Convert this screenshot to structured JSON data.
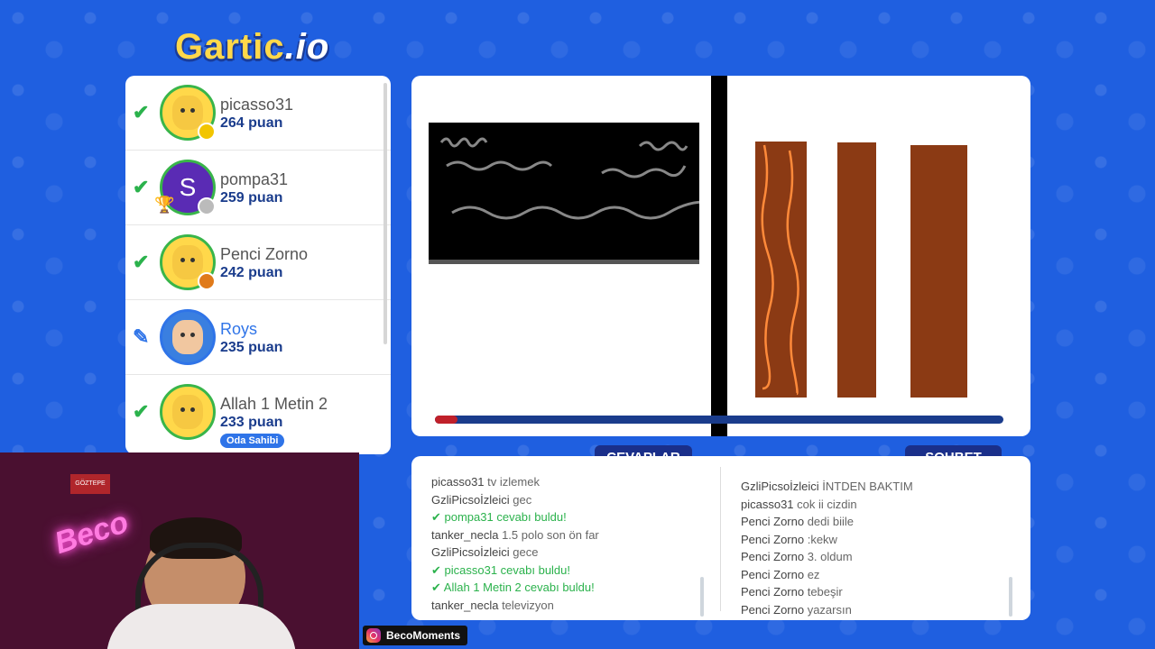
{
  "logo": {
    "name": "Gartic",
    "suffix": ".io"
  },
  "players": [
    {
      "name": "picasso31",
      "score": "264 puan",
      "status": "correct",
      "dot": "#f2c500"
    },
    {
      "name": "pompa31",
      "score": "259 puan",
      "status": "correct",
      "avatar_letter": "S",
      "rank_badge": "1",
      "dot": "#bbbbbb"
    },
    {
      "name": "Penci Zorno",
      "score": "242 puan",
      "status": "correct",
      "dot": "#e07a1a"
    },
    {
      "name": "Roys",
      "score": "235 puan",
      "status": "drawing"
    },
    {
      "name": "Allah 1 Metin 2",
      "score": "233 puan",
      "status": "correct",
      "badge": "Oda Sahibi"
    }
  ],
  "timer": {
    "remaining_fraction": 0.04
  },
  "tabs": {
    "answers": "CEVAPLAR",
    "chat": "SOHBET"
  },
  "answers": [
    {
      "user": "picasso31",
      "text": "tv izlemek"
    },
    {
      "user": "GzliPicsoİzleici",
      "text": "gec"
    },
    {
      "user": "pompa31",
      "text": "cevabı buldu!",
      "correct": true
    },
    {
      "user": "tanker_necla",
      "text": "1.5 polo son ön far"
    },
    {
      "user": "GzliPicsoİzleici",
      "text": "gece"
    },
    {
      "user": "picasso31",
      "text": "cevabı buldu!",
      "correct": true
    },
    {
      "user": "Allah 1 Metin 2",
      "text": "cevabı buldu!",
      "correct": true
    },
    {
      "user": "tanker_necla",
      "text": "televizyon"
    }
  ],
  "chat": [
    {
      "user": "GzliPicsoİzleici",
      "text": "İNTDEN BAKTIM"
    },
    {
      "user": "picasso31",
      "text": "cok ii cizdin"
    },
    {
      "user": "Penci Zorno",
      "text": "dedi biile"
    },
    {
      "user": "Penci Zorno",
      "text": ":kekw"
    },
    {
      "user": "Penci Zorno",
      "text": "3. oldum"
    },
    {
      "user": "Penci Zorno",
      "text": "ez"
    },
    {
      "user": "Penci Zorno",
      "text": "tebeşir"
    },
    {
      "user": "Penci Zorno",
      "text": "yazarsın"
    }
  ],
  "webcam": {
    "neon_text": "Beco",
    "sticker": "GÖZTEPE"
  },
  "instagram": {
    "handle": "BecoMoments"
  },
  "colors": {
    "correct": "#2bb24c",
    "accent": "#2f74e8",
    "tab": "#1a2f8a",
    "plank": "#8b3a14"
  }
}
